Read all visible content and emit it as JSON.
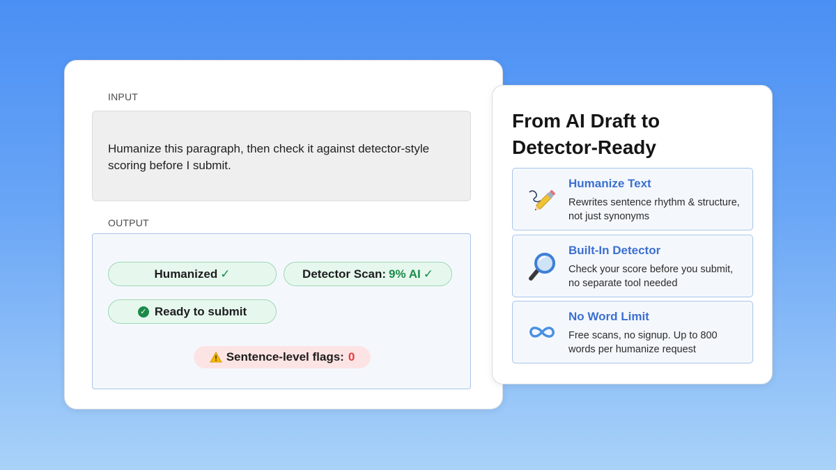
{
  "input": {
    "label": "INPUT",
    "text": "Humanize this paragraph, then check it against detector-style scoring before I submit."
  },
  "output": {
    "label": "OUTPUT",
    "humanized_label": "Humanized",
    "scan_label": "Detector Scan:",
    "scan_value": "9% AI",
    "check_mark": "✓",
    "ready_label": "Ready to submit",
    "flags_label": "Sentence-level flags:",
    "flags_count": "0"
  },
  "panel": {
    "title": "From AI Draft to Detector-Ready",
    "features": [
      {
        "name": "Humanize Text",
        "description": "Rewrites sentence rhythm & structure, not just synonyms",
        "icon": "pen-icon"
      },
      {
        "name": "Built-In Detector",
        "description": "Check your score before you submit, no separate tool needed",
        "icon": "magnifier-icon"
      },
      {
        "name": "No Word Limit",
        "description": "Free scans, no signup. Up to 800 words per humanize request",
        "icon": "infinity-icon"
      }
    ]
  },
  "colors": {
    "accent_blue": "#3c6fd0",
    "success_green": "#1c8a4a",
    "alert_red": "#e53b3b"
  }
}
